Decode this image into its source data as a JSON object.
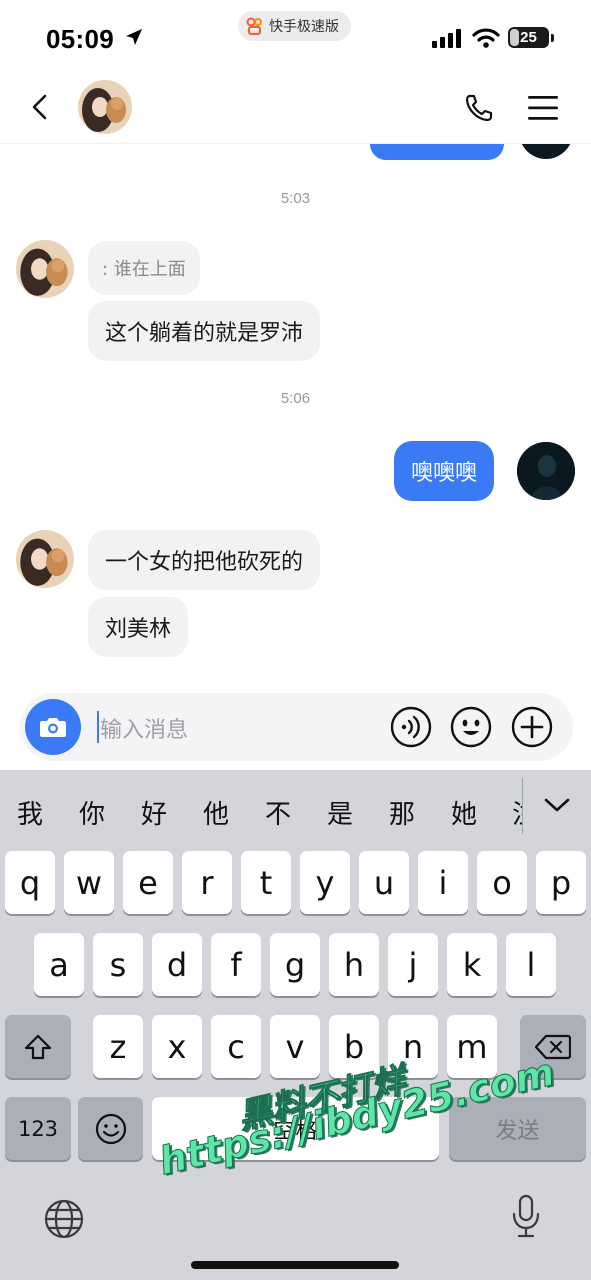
{
  "status_bar": {
    "time": "05:09",
    "app_pill": "快手极速版",
    "battery": "25",
    "battery_level": 0.25
  },
  "nav": {
    "icons": [
      "back-icon",
      "contact-avatar",
      "phone-icon",
      "menu-icon"
    ]
  },
  "chat": {
    "timestamps": [
      "5:03",
      "5:06"
    ],
    "messages": [
      {
        "from": "other",
        "text": ": 谁在上面",
        "kind": "quote"
      },
      {
        "from": "other",
        "text": "这个躺着的就是罗沛"
      },
      {
        "from": "me",
        "text": "噢噢噢"
      },
      {
        "from": "other",
        "text": "一个女的把他砍死的"
      },
      {
        "from": "other",
        "text": "刘美林"
      }
    ]
  },
  "input": {
    "placeholder": "输入消息",
    "icons": [
      "camera-icon",
      "voice-icon",
      "emoji-icon",
      "plus-icon"
    ]
  },
  "keyboard": {
    "candidates": [
      "我",
      "你",
      "好",
      "他",
      "不",
      "是",
      "那",
      "她",
      "注"
    ],
    "row1": [
      "q",
      "w",
      "e",
      "r",
      "t",
      "y",
      "u",
      "i",
      "o",
      "p"
    ],
    "row2": [
      "a",
      "s",
      "d",
      "f",
      "g",
      "h",
      "j",
      "k",
      "l"
    ],
    "row3": [
      "z",
      "x",
      "c",
      "v",
      "b",
      "n",
      "m"
    ],
    "num_label": "123",
    "space_label": "空格",
    "send_label": "发送"
  },
  "watermark": {
    "line1": "黑料不打烊",
    "line2": "https://ibdy25.com"
  },
  "colors": {
    "accent": "#3a7bf5",
    "bubble_other": "#f2f2f4",
    "keyboard_bg": "#d3d5db",
    "watermark": "#5ee6a6"
  }
}
